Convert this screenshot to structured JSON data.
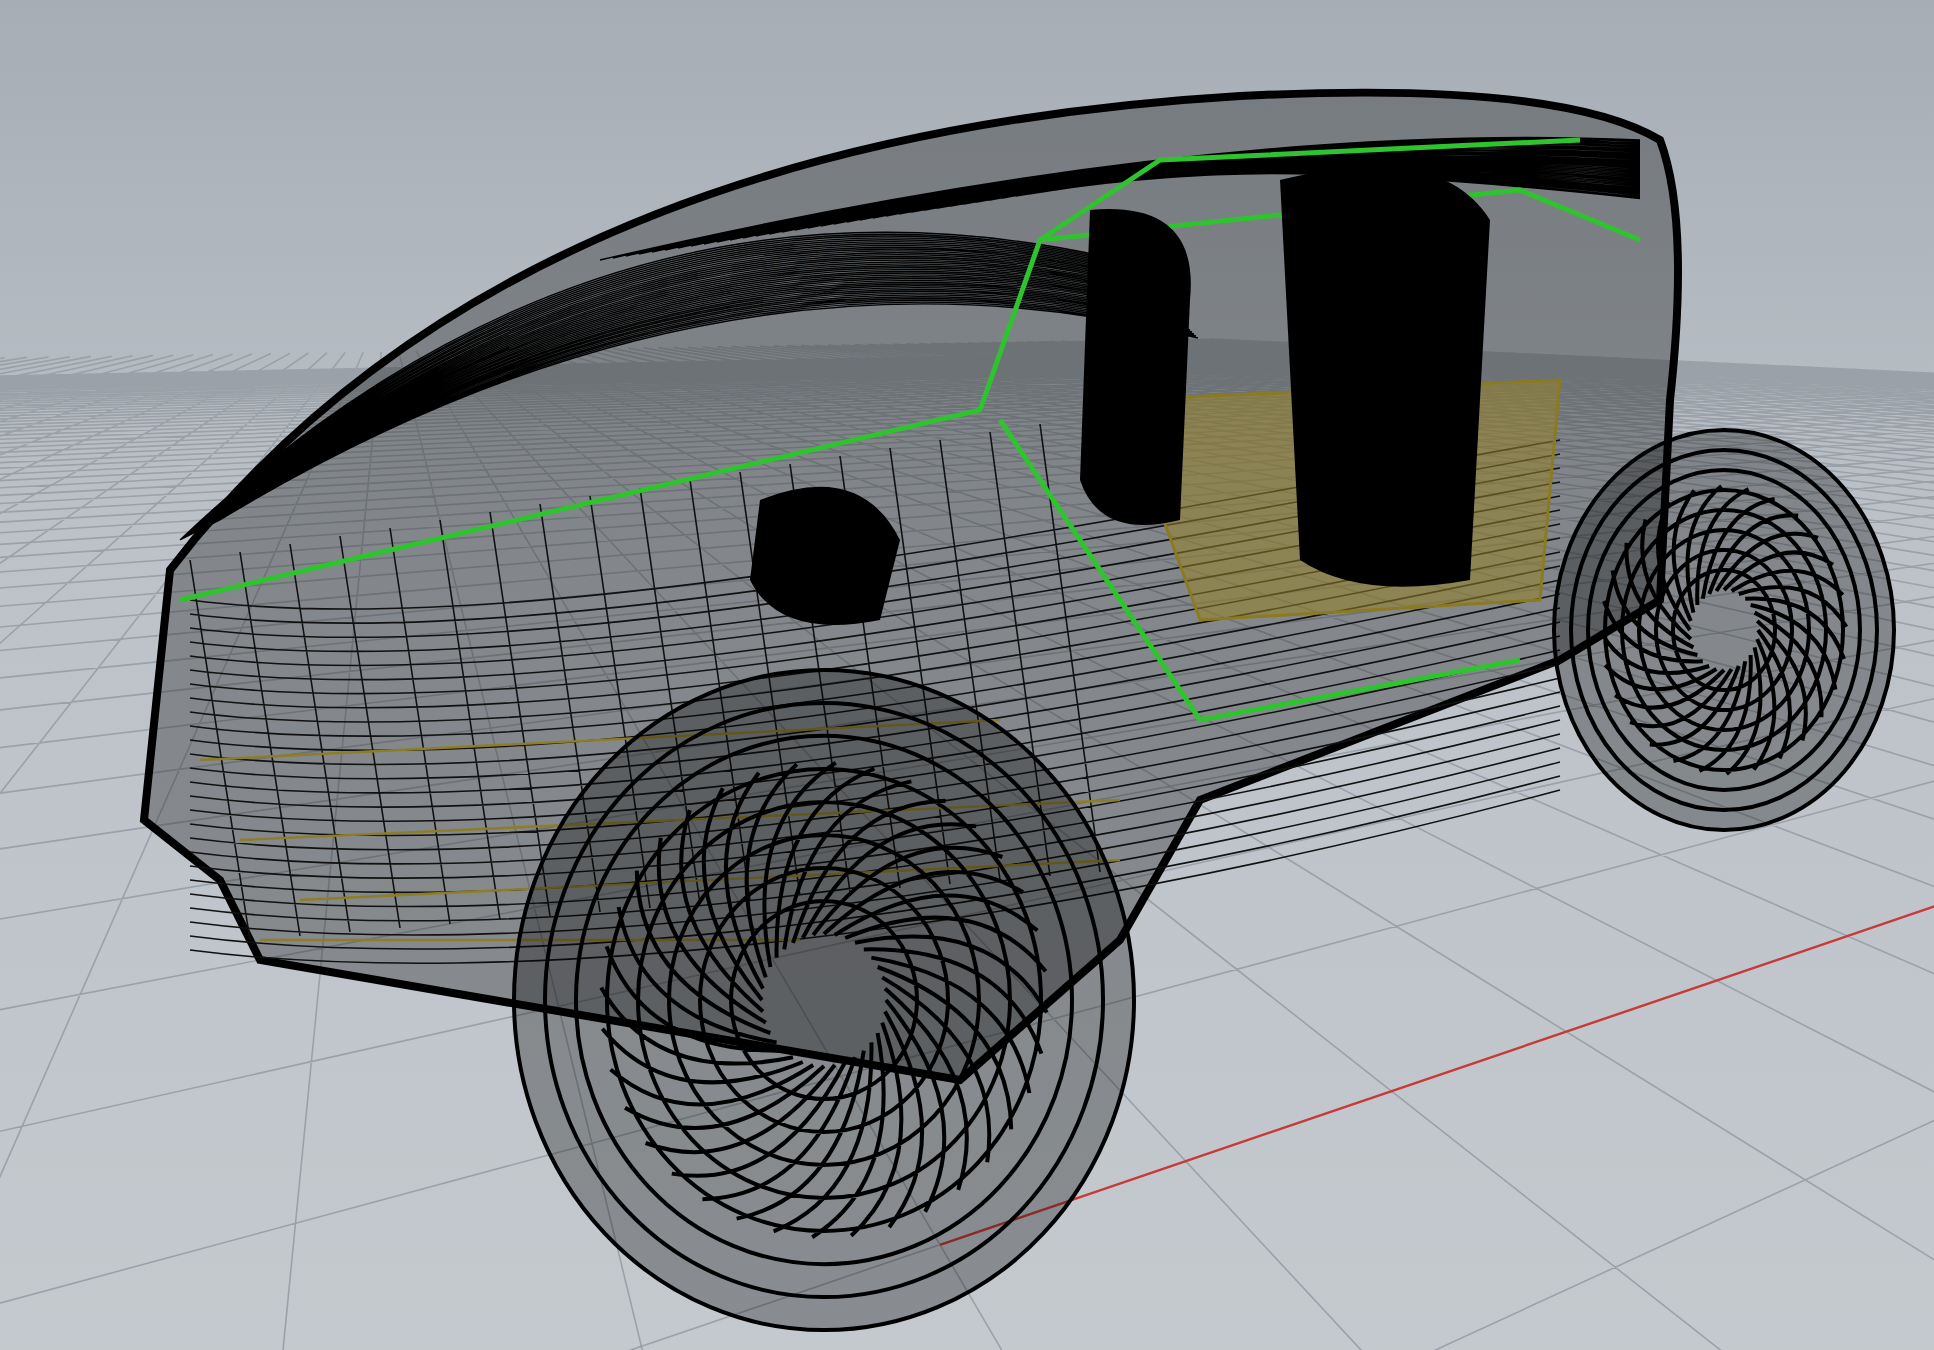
{
  "viewport": {
    "grid": true,
    "axes": true,
    "model_visible": true
  }
}
